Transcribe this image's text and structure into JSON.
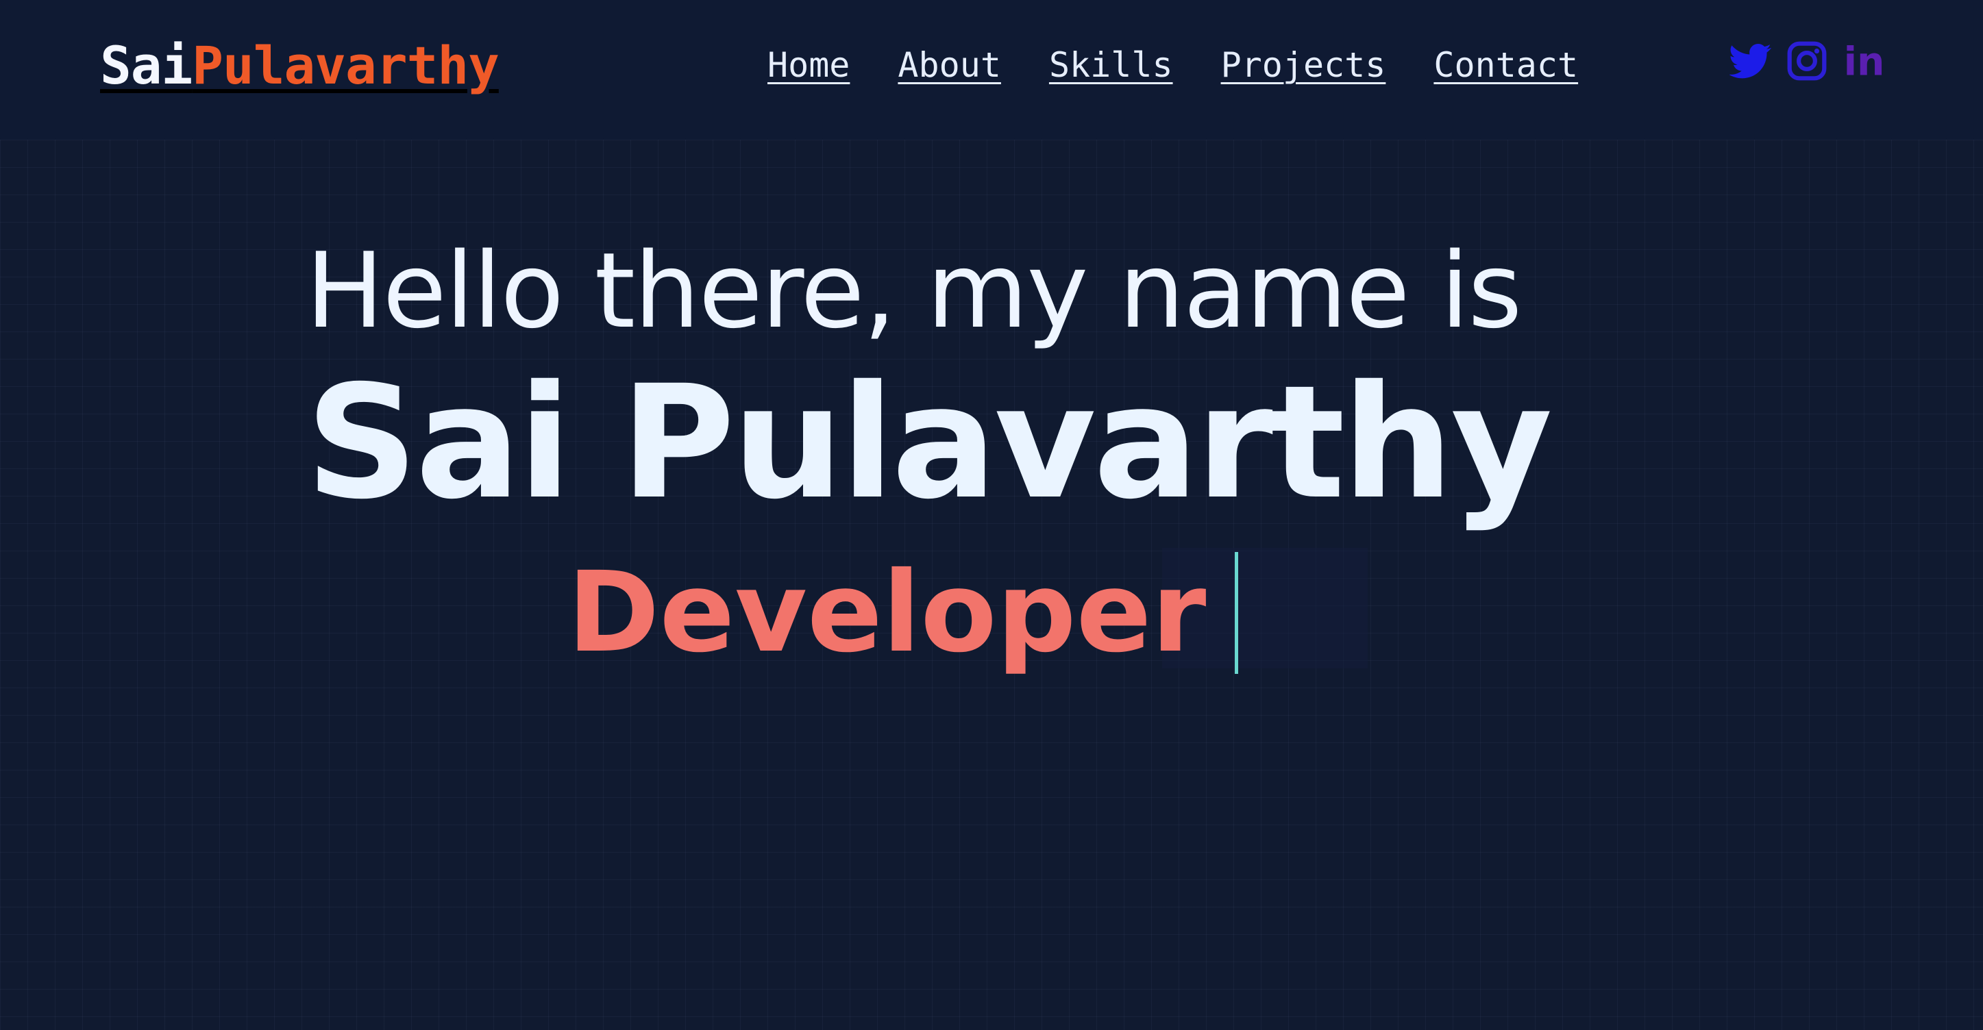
{
  "header": {
    "logo": {
      "first": "Sai",
      "last": "Pulavarthy"
    },
    "nav": [
      "Home",
      "About",
      "Skills",
      "Projects",
      "Contact"
    ],
    "social": {
      "twitter_icon": "twitter-icon",
      "instagram_icon": "instagram-icon",
      "linkedin_icon": "linkedin-icon",
      "linkedin_text": "in"
    }
  },
  "hero": {
    "greeting": "Hello there, my name is",
    "name": "Sai Pulavarthy",
    "role": "Developer"
  },
  "colors": {
    "background": "#101a30",
    "accent_orange": "#f05a28",
    "role_coral": "#f2746b",
    "cursor_teal": "#6ad8d0",
    "twitter_blue": "#1c1ce8",
    "instagram_blue": "#2c1fd6",
    "linkedin_purple": "#5a1fb0"
  }
}
